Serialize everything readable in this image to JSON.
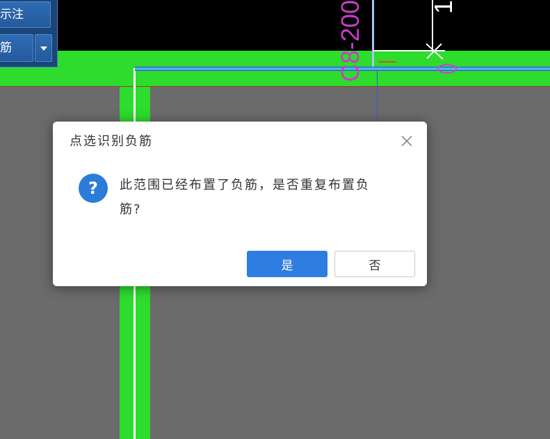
{
  "toolbar": {
    "items": [
      {
        "label": "示注"
      },
      {
        "label": "筋",
        "dropdown_icon": "caret-down-icon"
      }
    ]
  },
  "canvas": {
    "rebar_annotation": "C8-200",
    "dimension_text": "1"
  },
  "dialog": {
    "title": "点选识别负筋",
    "close_icon": "close-icon",
    "message_icon": "question-icon",
    "message_icon_glyph": "?",
    "message": "此范围已经布置了负筋，是否重复布置负筋?",
    "buttons": {
      "yes": "是",
      "no": "否"
    }
  },
  "colors": {
    "canvas_background": "#6b6b6b",
    "canvas_top": "#000000",
    "beam_green": "#2ddc2d",
    "rebar_line_blue": "#58a9f4",
    "annotation_magenta": "#c83ec8",
    "toolbar_blue": "#1b4478",
    "primary_button": "#2e7de0",
    "question_icon": "#2b7cd9"
  }
}
